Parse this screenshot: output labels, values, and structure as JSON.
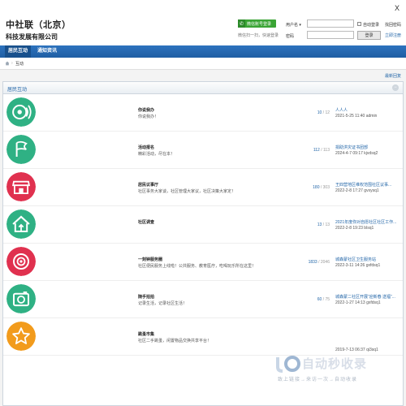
{
  "header": {
    "logo_main": "中社联（北京）",
    "logo_sub": "科技发展有限公司",
    "close": "X",
    "wechat_login": "微信账号登录",
    "wechat_hint": "微信扫一扫，快速登录",
    "username_label": "用户名",
    "password_label": "密码",
    "auto_login": "自动登录",
    "forgot_password": "找回密码",
    "login_button": "登录",
    "register": "立即注册"
  },
  "nav": {
    "items": [
      {
        "label": "居民互动"
      },
      {
        "label": "通知资讯"
      }
    ]
  },
  "breadcrumb": {
    "separator": "›",
    "current": "互动"
  },
  "newest_reply": "最新回复",
  "forum": {
    "title": "居民互动",
    "rows": [
      {
        "name": "你说我办",
        "desc": "你说我办！",
        "threads": "10",
        "posts": "12",
        "last_title": "人人人",
        "last_meta": "2021-5-25 11:40 admin",
        "color": "#2fb184",
        "icon": "sound-icon"
      },
      {
        "name": "活动报名",
        "desc": "精彩活动，尽在本！",
        "threads": "112",
        "posts": "113",
        "last_title": "捐助洪灾证书团部",
        "last_meta": "2024-4-7 09:17 kjvdsq2",
        "color": "#2fb184",
        "icon": "flag-icon"
      },
      {
        "name": "居民议事厅",
        "desc": "社区事务大家谈，社区管理大家议，社区决策大家定！",
        "threads": "180",
        "posts": "303",
        "last_title": "王四营地区维权范围社区议事...",
        "last_meta": "2022-2-8 17:27 gvxysq1",
        "color": "#e0314f",
        "icon": "shop-icon"
      },
      {
        "name": "社区调查",
        "desc": "",
        "threads": "13",
        "posts": "13",
        "last_title": "2021年度你对自愿社区社区工作...",
        "last_meta": "2022-2-8 19:23 blsq1",
        "color": "#2fb184",
        "icon": "home-icon"
      },
      {
        "name": "一刻钟服务圈",
        "desc": "社区便民服务上线啦！公共服务、教育医疗，吃喝玩乐所在这里！",
        "threads": "1833",
        "posts": "2046",
        "last_title": "城森蒙社区卫生服务站",
        "last_meta": "2022-3-11 14:26 gxfdsq1",
        "color": "#e0314f",
        "icon": "target-icon"
      },
      {
        "name": "随手拍拍",
        "desc": "记录生活，记录社区生活！",
        "threads": "60",
        "posts": "75",
        "last_title": "城森蒙二社区开展“迎新春 送福”...",
        "last_meta": "2022-1-27 14:13 gxfdsq1",
        "color": "#2fb184",
        "icon": "camera-icon"
      },
      {
        "name": "跳蚤市集",
        "desc": "社区二手跳蚤，闲置物品交换共享平台！",
        "threads": "",
        "posts": "",
        "last_title": "",
        "last_meta": "2019-7-13 06:37 qi3sq1",
        "color": "#f29b1c",
        "icon": "star-icon"
      }
    ]
  },
  "watermark": {
    "text": "自动秒收录",
    "sub": "致上链接→来访一次→自动收录"
  }
}
